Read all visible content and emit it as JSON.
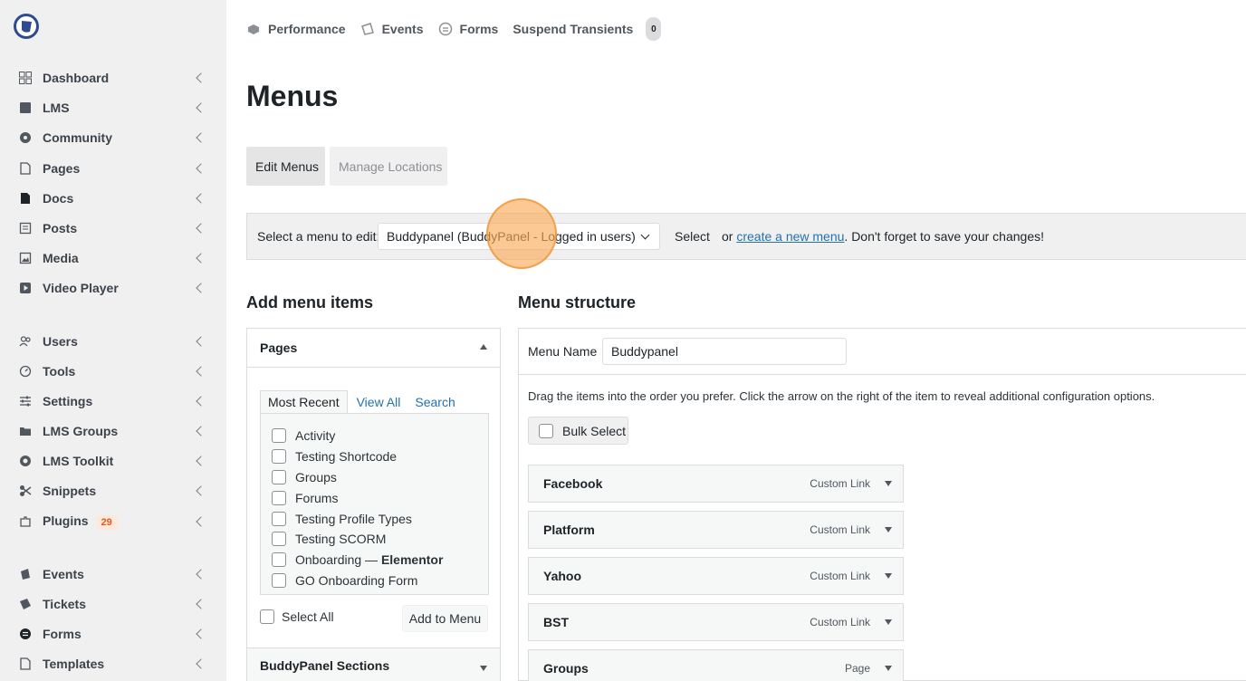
{
  "sidebar": {
    "items": [
      {
        "label": "Dashboard",
        "icon": "dashboard-icon"
      },
      {
        "label": "LMS",
        "icon": "book-icon"
      },
      {
        "label": "Community",
        "icon": "community-icon"
      },
      {
        "label": "Pages",
        "icon": "page-icon"
      },
      {
        "label": "Docs",
        "icon": "docs-icon"
      },
      {
        "label": "Posts",
        "icon": "posts-icon"
      },
      {
        "label": "Media",
        "icon": "media-icon"
      },
      {
        "label": "Video Player",
        "icon": "video-icon"
      },
      {
        "label": "Users",
        "icon": "users-icon"
      },
      {
        "label": "Tools",
        "icon": "tools-icon"
      },
      {
        "label": "Settings",
        "icon": "settings-icon"
      },
      {
        "label": "LMS Groups",
        "icon": "folder-icon"
      },
      {
        "label": "LMS Toolkit",
        "icon": "toolkit-icon"
      },
      {
        "label": "Snippets",
        "icon": "snippets-icon"
      },
      {
        "label": "Plugins",
        "icon": "plugin-icon",
        "badge": "29"
      },
      {
        "label": "Events",
        "icon": "events-icon"
      },
      {
        "label": "Tickets",
        "icon": "tickets-icon"
      },
      {
        "label": "Forms",
        "icon": "forms-icon"
      },
      {
        "label": "Templates",
        "icon": "templates-icon"
      }
    ]
  },
  "topbar": {
    "items": [
      {
        "label": "Performance",
        "icon": "performance-icon"
      },
      {
        "label": "Events",
        "icon": "events-icon"
      },
      {
        "label": "Forms",
        "icon": "forms-icon"
      },
      {
        "label": "Suspend Transients"
      }
    ],
    "count": "0"
  },
  "page": {
    "title": "Menus",
    "tabs": {
      "edit": "Edit Menus",
      "manage": "Manage Locations"
    }
  },
  "select_bar": {
    "label": "Select a menu to edit:",
    "selected": "Buddypanel (BuddyPanel - Logged in users)",
    "button": "Select",
    "or_text": "or",
    "link": "create a new menu",
    "suffix": ". Don't forget to save your changes!"
  },
  "add_items": {
    "heading": "Add menu items",
    "panel_title": "Pages",
    "tabs": [
      "Most Recent",
      "View All",
      "Search"
    ],
    "pages": [
      "Activity",
      "Testing Shortcode",
      "Groups",
      "Forums",
      "Testing Profile Types",
      "Testing SCORM"
    ],
    "onboarding_prefix": "Onboarding — ",
    "onboarding_strong": "Elementor",
    "last_page": "GO Onboarding Form",
    "select_all": "Select All",
    "add_button": "Add to Menu",
    "next_section": "BuddyPanel Sections"
  },
  "structure": {
    "heading": "Menu structure",
    "name_label": "Menu Name",
    "name_value": "Buddypanel",
    "help": "Drag the items into the order you prefer. Click the arrow on the right of the item to reveal additional configuration options.",
    "bulk_select": "Bulk Select",
    "items": [
      {
        "title": "Facebook",
        "type": "Custom Link"
      },
      {
        "title": "Platform",
        "type": "Custom Link"
      },
      {
        "title": "Yahoo",
        "type": "Custom Link"
      },
      {
        "title": "BST",
        "type": "Custom Link"
      },
      {
        "title": "Groups",
        "type": "Page"
      }
    ]
  },
  "colors": {
    "sidebar_bg": "#f0f0f1",
    "link": "#2271b1",
    "badge_text": "#e05a1f",
    "click_marker": "#f5a050"
  }
}
